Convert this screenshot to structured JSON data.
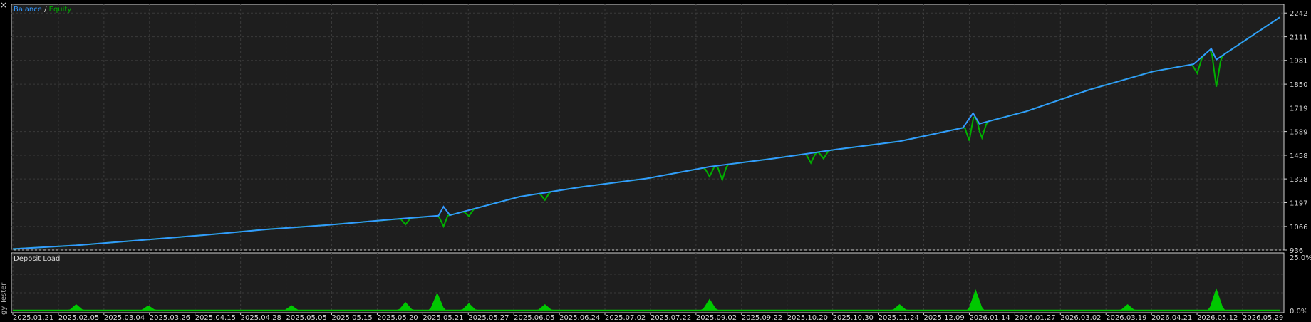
{
  "window": {
    "close_glyph": "×",
    "side_tab_label": "gy Tester"
  },
  "chart_data": [
    {
      "type": "line",
      "legend": {
        "placement": "top-left",
        "entries": [
          {
            "label": "Balance",
            "color": "#3399ff"
          },
          {
            "label": "Equity",
            "color": "#00b000"
          }
        ],
        "separator": " / "
      },
      "ylim": [
        936,
        2290
      ],
      "yticks": [
        936,
        1066,
        1197,
        1328,
        1458,
        1589,
        1719,
        1850,
        1981,
        2111,
        2242
      ],
      "grid": true,
      "balance_points": [
        [
          0,
          942
        ],
        [
          0.05,
          962
        ],
        [
          0.1,
          990
        ],
        [
          0.15,
          1018
        ],
        [
          0.2,
          1050
        ],
        [
          0.25,
          1075
        ],
        [
          0.3,
          1105
        ],
        [
          0.336,
          1125
        ],
        [
          0.34,
          1175
        ],
        [
          0.345,
          1128
        ],
        [
          0.4,
          1230
        ],
        [
          0.45,
          1285
        ],
        [
          0.5,
          1330
        ],
        [
          0.55,
          1395
        ],
        [
          0.6,
          1440
        ],
        [
          0.65,
          1490
        ],
        [
          0.7,
          1535
        ],
        [
          0.75,
          1610
        ],
        [
          0.758,
          1690
        ],
        [
          0.763,
          1632
        ],
        [
          0.8,
          1700
        ],
        [
          0.85,
          1820
        ],
        [
          0.9,
          1920
        ],
        [
          0.932,
          1960
        ],
        [
          0.946,
          2045
        ],
        [
          0.95,
          1985
        ],
        [
          1.0,
          2218
        ]
      ],
      "equity_dips": [
        [
          0.31,
          0.025
        ],
        [
          0.34,
          0.08
        ],
        [
          0.36,
          0.025
        ],
        [
          0.42,
          0.03
        ],
        [
          0.55,
          0.04
        ],
        [
          0.56,
          0.06
        ],
        [
          0.63,
          0.04
        ],
        [
          0.64,
          0.03
        ],
        [
          0.755,
          0.09
        ],
        [
          0.765,
          0.06
        ],
        [
          0.935,
          0.05
        ],
        [
          0.95,
          0.11
        ]
      ]
    },
    {
      "type": "area",
      "title": "Deposit Load",
      "ylim": [
        0,
        25
      ],
      "yticks": [
        "25.0%",
        "0.0%"
      ],
      "grid": true,
      "series_color": "#00c800",
      "spikes": [
        [
          0.05,
          3.0
        ],
        [
          0.107,
          2.5
        ],
        [
          0.22,
          2.5
        ],
        [
          0.31,
          4.0
        ],
        [
          0.335,
          8.5
        ],
        [
          0.36,
          3.5
        ],
        [
          0.42,
          3.0
        ],
        [
          0.55,
          5.5
        ],
        [
          0.7,
          3.0
        ],
        [
          0.76,
          10.0
        ],
        [
          0.88,
          3.0
        ],
        [
          0.95,
          10.5
        ]
      ]
    }
  ],
  "x_axis": {
    "labels": [
      "2025.01.21",
      "2025.02.05",
      "2025.03.04",
      "2025.03.26",
      "2025.04.15",
      "2025.04.28",
      "2025.05.05",
      "2025.05.15",
      "2025.05.20",
      "2025.05.21",
      "2025.05.27",
      "2025.06.05",
      "2025.06.24",
      "2025.07.02",
      "2025.07.22",
      "2025.09.02",
      "2025.09.22",
      "2025.10.20",
      "2025.10.30",
      "2025.11.24",
      "2025.12.09",
      "2026.01.14",
      "2026.01.27",
      "2026.03.02",
      "2026.03.19",
      "2026.04.21",
      "2026.05.12",
      "2026.05.29"
    ]
  }
}
